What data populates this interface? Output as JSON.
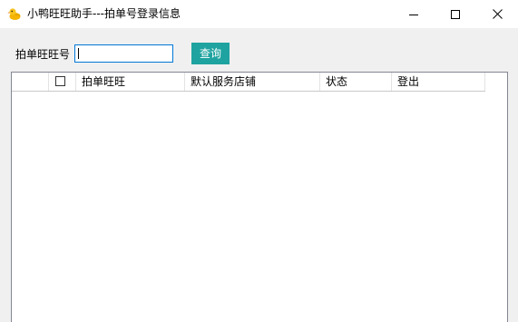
{
  "window": {
    "title": "小鸭旺旺助手---拍单号登录信息",
    "icon": "duck-app-icon"
  },
  "controls": {
    "minimize_icon": "minimize-icon",
    "maximize_icon": "maximize-icon",
    "close_icon": "close-icon"
  },
  "query": {
    "label": "拍单旺旺号",
    "value": "",
    "button_label": "查询",
    "button_color": "#1fa3a0"
  },
  "grid": {
    "columns": [
      "",
      "拍单旺旺",
      "默认服务店铺",
      "状态",
      "登出"
    ],
    "rows": []
  },
  "colors": {
    "window_bg": "#f0f0f0",
    "titlebar_bg": "#ffffff",
    "focus_border": "#0078d7"
  }
}
